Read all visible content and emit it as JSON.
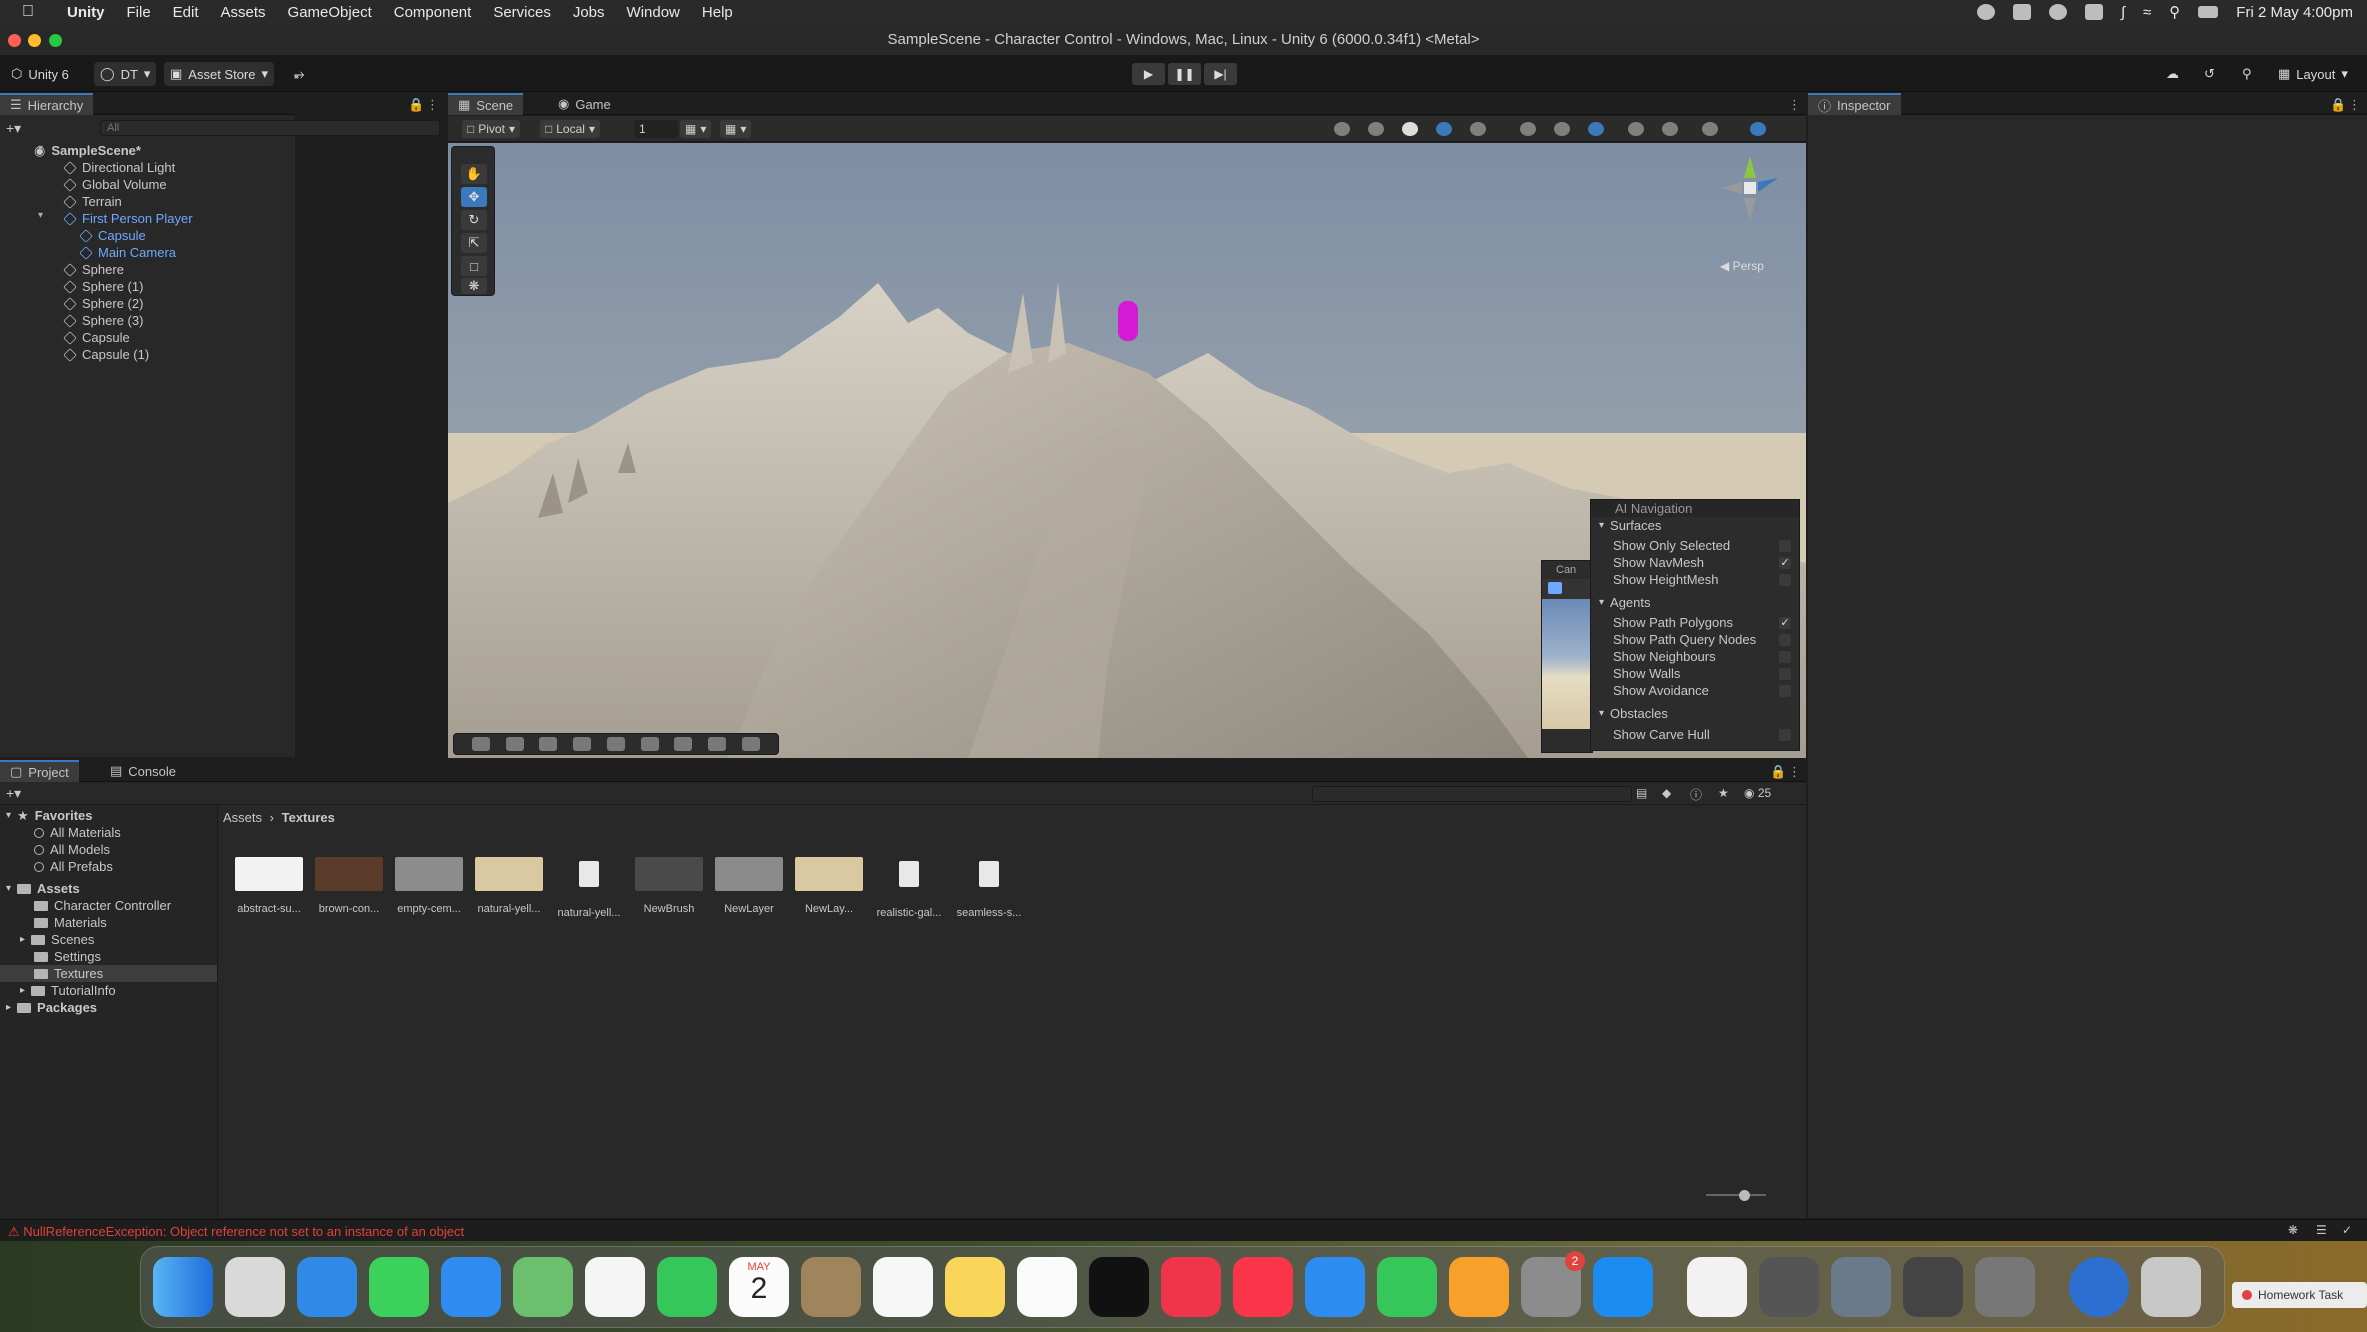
{
  "menubar": {
    "app_name": "Unity",
    "items": [
      "File",
      "Edit",
      "Assets",
      "GameObject",
      "Component",
      "Services",
      "Jobs",
      "Window",
      "Help"
    ],
    "datetime": "Fri 2 May  4:00pm"
  },
  "window": {
    "title": "SampleScene - Character Control - Windows, Mac, Linux - Unity 6 (6000.0.34f1) <Metal>"
  },
  "toolbar": {
    "unity_label": "Unity 6",
    "account_label": "DT",
    "asset_store_label": "Asset Store",
    "layout_label": "Layout"
  },
  "hierarchy": {
    "tab_label": "Hierarchy",
    "search_placeholder": "All",
    "scene_name": "SampleScene*",
    "items": [
      {
        "label": "Directional Light"
      },
      {
        "label": "Global Volume"
      },
      {
        "label": "Terrain"
      },
      {
        "label": "First Person Player"
      },
      {
        "label": "Capsule"
      },
      {
        "label": "Main Camera"
      },
      {
        "label": "Sphere"
      },
      {
        "label": "Sphere (1)"
      },
      {
        "label": "Sphere (2)"
      },
      {
        "label": "Sphere (3)"
      },
      {
        "label": "Capsule"
      },
      {
        "label": "Capsule (1)"
      }
    ]
  },
  "scene": {
    "tabs": [
      "Scene",
      "Game"
    ],
    "pivot_label": "Pivot",
    "local_label": "Local",
    "grid_value": "1",
    "persp_label": "Persp"
  },
  "ai_navigation": {
    "title": "AI Navigation",
    "surfaces_header": "Surfaces",
    "surfaces": [
      {
        "label": "Show Only Selected",
        "checked": false
      },
      {
        "label": "Show NavMesh",
        "checked": true
      },
      {
        "label": "Show HeightMesh",
        "checked": false
      }
    ],
    "agents_header": "Agents",
    "agents": [
      {
        "label": "Show Path Polygons",
        "checked": true
      },
      {
        "label": "Show Path Query Nodes",
        "checked": false
      },
      {
        "label": "Show Neighbours",
        "checked": false
      },
      {
        "label": "Show Walls",
        "checked": false
      },
      {
        "label": "Show Avoidance",
        "checked": false
      }
    ],
    "obstacles_header": "Obstacles",
    "obstacles": [
      {
        "label": "Show Carve Hull",
        "checked": false
      }
    ],
    "camera_overlay_label": "Can"
  },
  "inspector": {
    "tab_label": "Inspector"
  },
  "project": {
    "tabs": [
      "Project",
      "Console"
    ],
    "visible_count": "25",
    "favorites_label": "Favorites",
    "favorites": [
      "All Materials",
      "All Models",
      "All Prefabs"
    ],
    "assets_label": "Assets",
    "asset_folders": [
      "Character Controller",
      "Materials",
      "Scenes",
      "Settings",
      "Textures",
      "TutorialInfo"
    ],
    "packages_label": "Packages",
    "breadcrumb": [
      "Assets",
      "Textures"
    ],
    "assets": [
      {
        "name": "abstract-su...",
        "color": "#f2f2f2"
      },
      {
        "name": "brown-con...",
        "color": "#5a3a28"
      },
      {
        "name": "empty-cem...",
        "color": "#8c8c8c"
      },
      {
        "name": "natural-yell...",
        "color": "#d9c8a0"
      },
      {
        "name": "natural-yell...",
        "color": "doc"
      },
      {
        "name": "NewBrush",
        "color": "#4a4a4a"
      },
      {
        "name": "NewLayer",
        "color": "#8a8a8a"
      },
      {
        "name": "NewLay...",
        "color": "#d9c8a0"
      },
      {
        "name": "realistic-gal...",
        "color": "doc"
      },
      {
        "name": "seamless-s...",
        "color": "doc"
      }
    ]
  },
  "status": {
    "error": "NullReferenceException: Object reference not set to an instance of an object"
  },
  "dock": {
    "calendar_month": "MAY",
    "calendar_day": "2",
    "settings_badge": "2",
    "homework_label": "Homework Task"
  },
  "colors": {
    "accent": "#3a79bb",
    "selection_blue": "#6fa8ff",
    "error_red": "#e0423d",
    "player_capsule": "#d41ad4"
  }
}
